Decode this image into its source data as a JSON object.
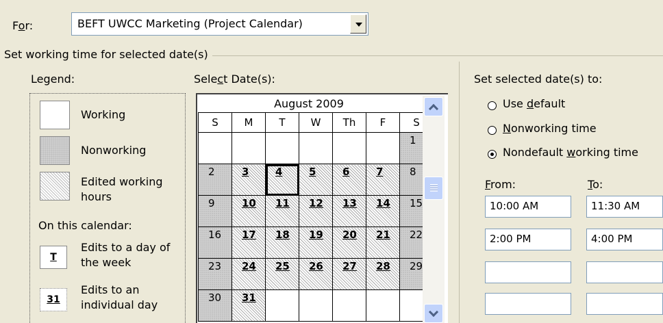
{
  "for_row": {
    "label_pre": "F",
    "label_ul": "o",
    "label_post": "r:",
    "value": "BEFT UWCC Marketing (Project Calendar)"
  },
  "group_title": "Set working time for selected date(s)",
  "legend": {
    "title": "Legend:",
    "working": "Working",
    "nonworking": "Nonworking",
    "edited_line1": "Edited working",
    "edited_line2": "hours",
    "on_calendar": "On this calendar:",
    "day_week_line1": "Edits to a day of",
    "day_week_line2": "the week",
    "day_week_box": "T",
    "indiv_line1": "Edits to an",
    "indiv_line2": "individual day",
    "indiv_box": "31"
  },
  "calendar": {
    "label_pre": "Sele",
    "label_ul": "c",
    "label_post": "t Date(s):",
    "month": "August 2009",
    "weekdays": [
      "S",
      "M",
      "T",
      "W",
      "Th",
      "F",
      "S"
    ],
    "weeks": [
      [
        "",
        "",
        "",
        "",
        "",
        "",
        "1"
      ],
      [
        "2",
        "3",
        "4",
        "5",
        "6",
        "7",
        "8"
      ],
      [
        "9",
        "10",
        "11",
        "12",
        "13",
        "14",
        "15"
      ],
      [
        "16",
        "17",
        "18",
        "19",
        "20",
        "21",
        "22"
      ],
      [
        "23",
        "24",
        "25",
        "26",
        "27",
        "28",
        "29"
      ],
      [
        "30",
        "31",
        "",
        "",
        "",
        "",
        ""
      ]
    ]
  },
  "set_to": {
    "title": "Set selected date(s) to:",
    "use_default_pre": "Use ",
    "use_default_ul": "d",
    "use_default_post": "efault",
    "nonworking_ul": "N",
    "nonworking_post": "onworking time",
    "nondefault_pre": "Nondefault ",
    "nondefault_ul": "w",
    "nondefault_post": "orking time",
    "selected": "nondefault"
  },
  "times": {
    "from_ul": "F",
    "from_post": "rom:",
    "to_ul": "T",
    "to_post": "o:",
    "rows": [
      {
        "from": "10:00 AM",
        "to": "11:30 AM"
      },
      {
        "from": "2:00 PM",
        "to": "4:00 PM"
      },
      {
        "from": "",
        "to": ""
      },
      {
        "from": "",
        "to": ""
      }
    ]
  }
}
